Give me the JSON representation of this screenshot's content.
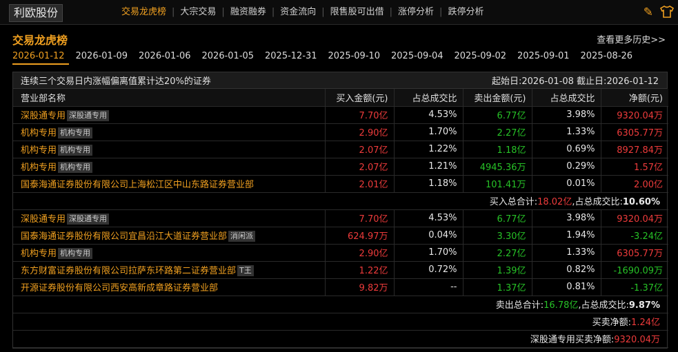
{
  "stock_name": "利欧股份",
  "nav": [
    "交易龙虎榜",
    "大宗交易",
    "融资融券",
    "资金流向",
    "限售股可出借",
    "涨停分析",
    "跌停分析"
  ],
  "title": "交易龙虎榜",
  "more_link": "查看更多历史>>",
  "dates": [
    "2026-01-12",
    "2026-01-09",
    "2026-01-06",
    "2026-01-05",
    "2025-12-31",
    "2025-09-10",
    "2025-09-04",
    "2025-09-02",
    "2025-09-01",
    "2025-08-26"
  ],
  "table": {
    "caption_left": "连续三个交易日内涨幅偏离值累计达20%的证券",
    "caption_right": "起始日:2026-01-08  截止日:2026-01-12",
    "headers": [
      "营业部名称",
      "买入金额(元)",
      "占总成交比",
      "卖出金额(元)",
      "占总成交比",
      "净额(元)"
    ],
    "buy_rows": [
      {
        "name": "深股通专用",
        "tag": "深股通专用",
        "buy": "7.70亿",
        "buy_pct": "4.53%",
        "sell": "6.77亿",
        "sell_pct": "3.98%",
        "net": "9320.04万",
        "net_color": "red"
      },
      {
        "name": "机构专用",
        "tag": "机构专用",
        "buy": "2.90亿",
        "buy_pct": "1.70%",
        "sell": "2.27亿",
        "sell_pct": "1.33%",
        "net": "6305.77万",
        "net_color": "red"
      },
      {
        "name": "机构专用",
        "tag": "机构专用",
        "buy": "2.07亿",
        "buy_pct": "1.22%",
        "sell": "1.18亿",
        "sell_pct": "0.69%",
        "net": "8927.84万",
        "net_color": "red"
      },
      {
        "name": "机构专用",
        "tag": "机构专用",
        "buy": "2.07亿",
        "buy_pct": "1.21%",
        "sell": "4945.36万",
        "sell_pct": "0.29%",
        "net": "1.57亿",
        "net_color": "red"
      },
      {
        "name": "国泰海通证券股份有限公司上海松江区中山东路证券营业部",
        "tag": "",
        "buy": "2.01亿",
        "buy_pct": "1.18%",
        "sell": "101.41万",
        "sell_pct": "0.01%",
        "net": "2.00亿",
        "net_color": "red"
      }
    ],
    "buy_total_label": "买入总合计:",
    "buy_total_value": "18.02亿",
    "buy_total_ratio_label": ",占总成交比:",
    "buy_total_ratio": "10.60%",
    "sell_rows": [
      {
        "name": "深股通专用",
        "tag": "深股通专用",
        "buy": "7.70亿",
        "buy_pct": "4.53%",
        "sell": "6.77亿",
        "sell_pct": "3.98%",
        "net": "9320.04万",
        "net_color": "red"
      },
      {
        "name": "国泰海通证券股份有限公司宜昌沿江大道证券营业部",
        "tag": "消闲派",
        "buy": "624.97万",
        "buy_pct": "0.04%",
        "sell": "3.30亿",
        "sell_pct": "1.94%",
        "net": "-3.24亿",
        "net_color": "green"
      },
      {
        "name": "机构专用",
        "tag": "机构专用",
        "buy": "2.90亿",
        "buy_pct": "1.70%",
        "sell": "2.27亿",
        "sell_pct": "1.33%",
        "net": "6305.77万",
        "net_color": "red"
      },
      {
        "name": "东方财富证券股份有限公司拉萨东环路第二证券营业部",
        "tag": "T王",
        "buy": "1.22亿",
        "buy_pct": "0.72%",
        "sell": "1.39亿",
        "sell_pct": "0.82%",
        "net": "-1690.09万",
        "net_color": "green"
      },
      {
        "name": "开源证券股份有限公司西安高新成章路证券营业部",
        "tag": "",
        "buy": "9.82万",
        "buy_pct": "--",
        "sell": "1.37亿",
        "sell_pct": "0.81%",
        "net": "-1.37亿",
        "net_color": "green"
      }
    ],
    "sell_total_label": "卖出总合计:",
    "sell_total_value": "16.78亿",
    "sell_total_ratio_label": ",占总成交比:",
    "sell_total_ratio": "9.87%",
    "net_label": "买卖净额:",
    "net_value": "1.24亿",
    "hk_net_label": "深股通专用买卖净额:",
    "hk_net_value": "9320.04万"
  },
  "colors": {
    "accent": "#f0a020",
    "up": "#ee3b3b",
    "down": "#27c227"
  },
  "icons": [
    "pencil-icon",
    "tshirt-icon"
  ]
}
